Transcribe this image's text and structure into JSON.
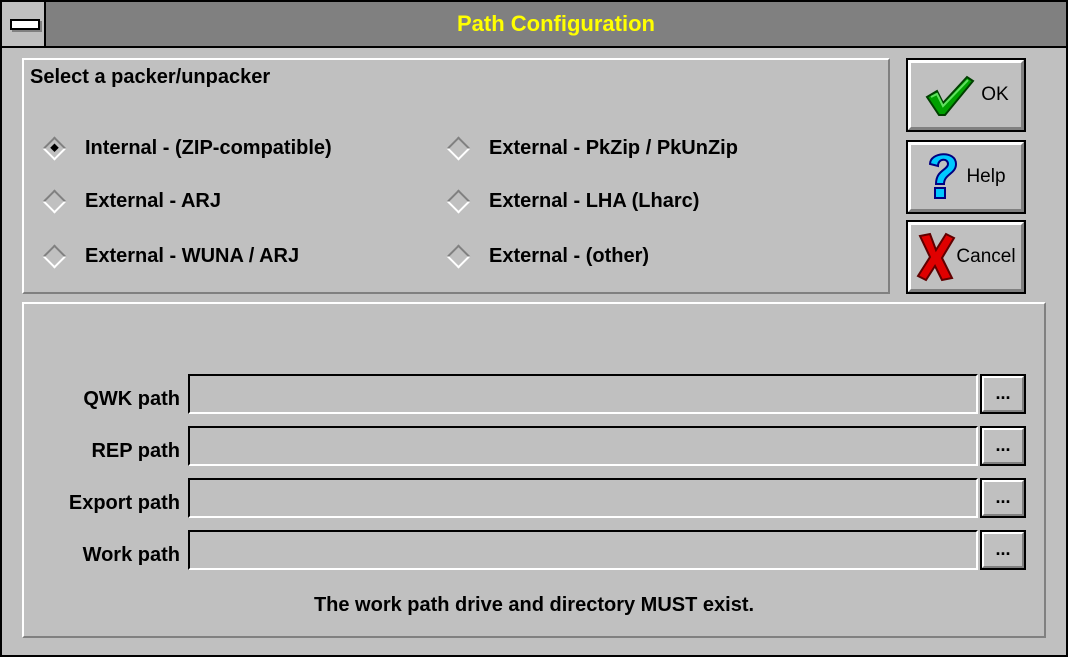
{
  "window": {
    "title": "Path Configuration"
  },
  "packer": {
    "label": "Select a packer/unpacker",
    "options": [
      {
        "label": "Internal - (ZIP-compatible)",
        "checked": true
      },
      {
        "label": "External - PkZip / PkUnZip",
        "checked": false
      },
      {
        "label": "External - ARJ",
        "checked": false
      },
      {
        "label": "External - LHA (Lharc)",
        "checked": false
      },
      {
        "label": "External - WUNA / ARJ",
        "checked": false
      },
      {
        "label": "External - (other)",
        "checked": false
      }
    ]
  },
  "buttons": {
    "ok": "OK",
    "help": "Help",
    "cancel": "Cancel"
  },
  "paths": {
    "qwk": {
      "label": "QWK path",
      "value": ""
    },
    "rep": {
      "label": "REP path",
      "value": ""
    },
    "export": {
      "label": "Export path",
      "value": ""
    },
    "work": {
      "label": "Work path",
      "value": ""
    },
    "browse_label": "..."
  },
  "note": "The work path drive and directory MUST exist."
}
